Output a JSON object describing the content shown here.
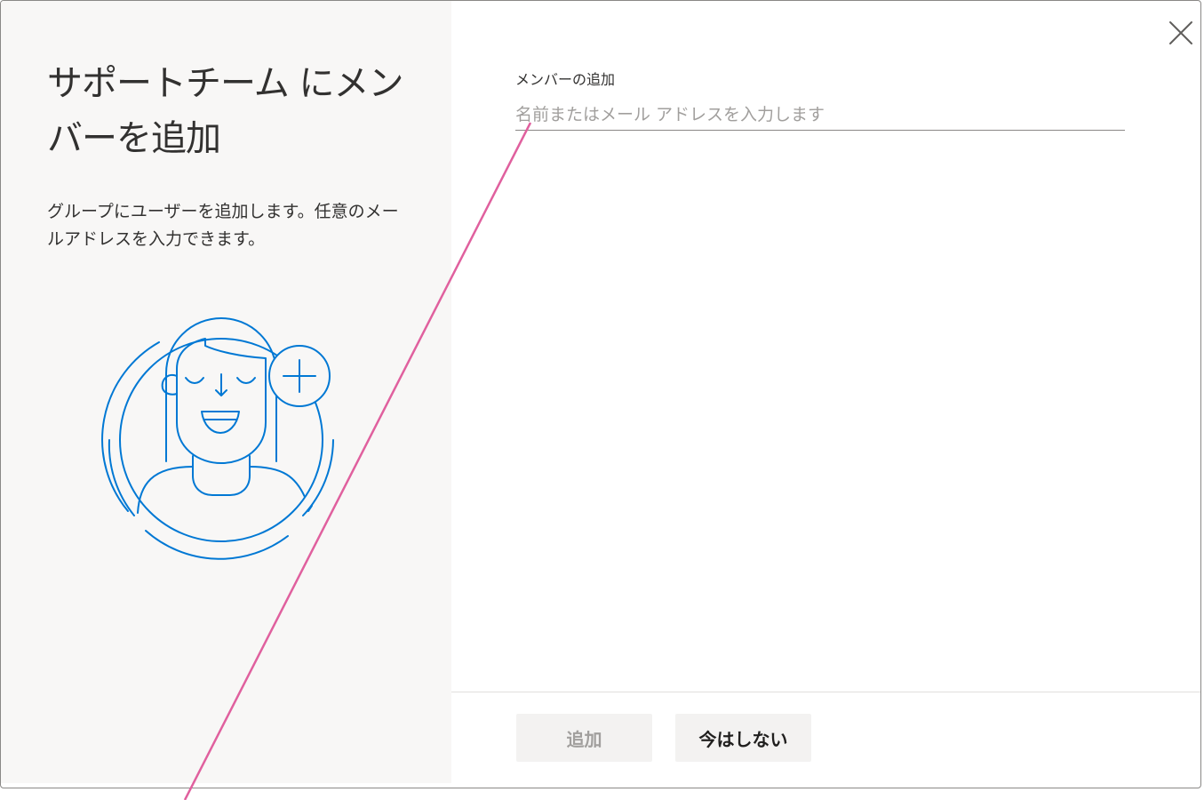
{
  "dialog": {
    "title": "サポートチーム にメンバーを追加",
    "description": "グループにユーザーを追加します。任意のメールアドレスを入力できます。",
    "illustration_icon": "person-add-illustration",
    "close_icon": "close-icon"
  },
  "form": {
    "label": "メンバーの追加",
    "input_value": "",
    "input_placeholder": "名前またはメール アドレスを入力します"
  },
  "footer": {
    "add_label": "追加",
    "later_label": "今はしない"
  },
  "colors": {
    "accent": "#0078d4",
    "panel_bg": "#f8f7f6",
    "annotation_line": "#e0609e"
  }
}
